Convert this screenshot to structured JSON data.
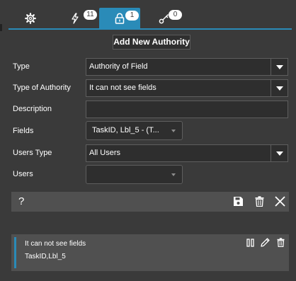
{
  "tabs": [
    {
      "icon": "gear-icon",
      "badge": null,
      "active": false
    },
    {
      "icon": "lightning-icon",
      "badge": "11",
      "active": false
    },
    {
      "icon": "lock-icon",
      "badge": "1",
      "active": true
    },
    {
      "icon": "key-icon",
      "badge": "0",
      "active": false
    }
  ],
  "form": {
    "title": "Add New Authority",
    "type": {
      "label": "Type",
      "value": "Authority of Field"
    },
    "type_of_authority": {
      "label": "Type of Authority",
      "value": "It can not see fields"
    },
    "description": {
      "label": "Description",
      "value": ""
    },
    "fields": {
      "label": "Fields",
      "value": "TaskID, Lbl_5 - (T..."
    },
    "users_type": {
      "label": "Users Type",
      "value": "All Users"
    },
    "users": {
      "label": "Users",
      "value": ""
    }
  },
  "toolbar": {
    "help_label": "?"
  },
  "authority_card": {
    "line1": "It can not see fields",
    "line2": "TaskID,Lbl_5"
  },
  "colors": {
    "accent": "#2a8bb8",
    "background": "#3a3a3a",
    "panel": "#505050"
  }
}
